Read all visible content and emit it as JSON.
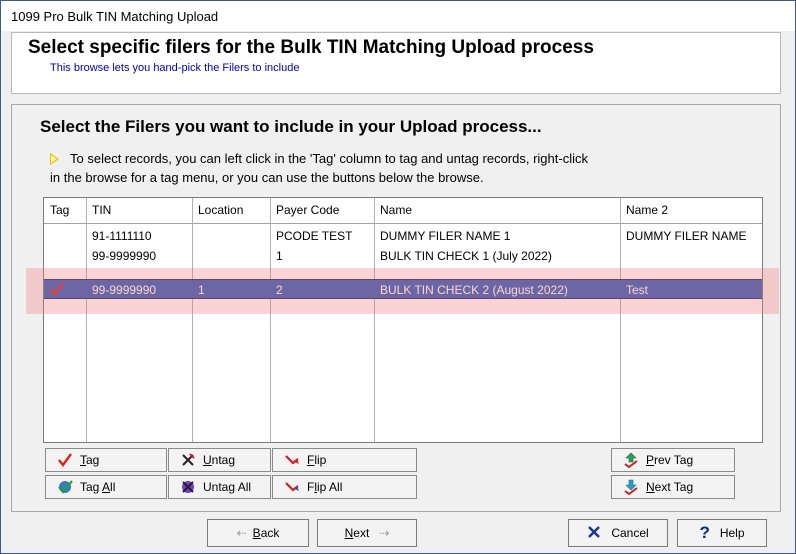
{
  "window": {
    "title": "1099 Pro Bulk TIN Matching Upload"
  },
  "header": {
    "title": "Select specific filers for the Bulk TIN Matching Upload process",
    "subtitle": "This browse lets you hand-pick the Filers to include"
  },
  "panel": {
    "title": "Select the Filers you want to include in your Upload process...",
    "instruction_line1": "To select records, you can left click in the 'Tag' column to tag and untag records, right-click",
    "instruction_line2": "in the browse for a tag menu, or you can use the buttons below the browse."
  },
  "table": {
    "columns": [
      "Tag",
      "TIN",
      "Location",
      "Payer Code",
      "Name",
      "Name 2"
    ],
    "rows": [
      {
        "tag": "",
        "tin": "91-1111110",
        "location": "",
        "payer_code": "PCODE TEST",
        "name": "DUMMY FILER NAME 1",
        "name2": "DUMMY FILER NAME",
        "selected": false
      },
      {
        "tag": "",
        "tin": "99-9999990",
        "location": "",
        "payer_code": "1",
        "name": "BULK TIN CHECK 1 (July 2022)",
        "name2": "",
        "selected": false
      },
      {
        "tag": "checked",
        "tin": "99-9999990",
        "location": "1",
        "payer_code": "2",
        "name": "BULK TIN CHECK 2 (August 2022)",
        "name2": "Test",
        "selected": true
      }
    ]
  },
  "buttons": {
    "tag": {
      "pre": "",
      "key": "T",
      "post": "ag"
    },
    "untag": {
      "pre": "",
      "key": "U",
      "post": "ntag"
    },
    "flip": {
      "pre": "",
      "key": "F",
      "post": "lip"
    },
    "prev_tag": {
      "pre": "",
      "key": "P",
      "post": "rev Tag"
    },
    "tag_all": {
      "pre": "Tag ",
      "key": "A",
      "post": "ll"
    },
    "untag_all": {
      "pre": "Unta",
      "key": "g",
      "post": " All"
    },
    "flip_all": {
      "pre": "F",
      "key": "l",
      "post": "ip All"
    },
    "next_tag": {
      "pre": "",
      "key": "N",
      "post": "ext Tag"
    }
  },
  "footer": {
    "back": {
      "key": "B",
      "post": "ack"
    },
    "next": {
      "key": "N",
      "post": "ext"
    },
    "cancel": "Cancel",
    "help": "Help"
  }
}
